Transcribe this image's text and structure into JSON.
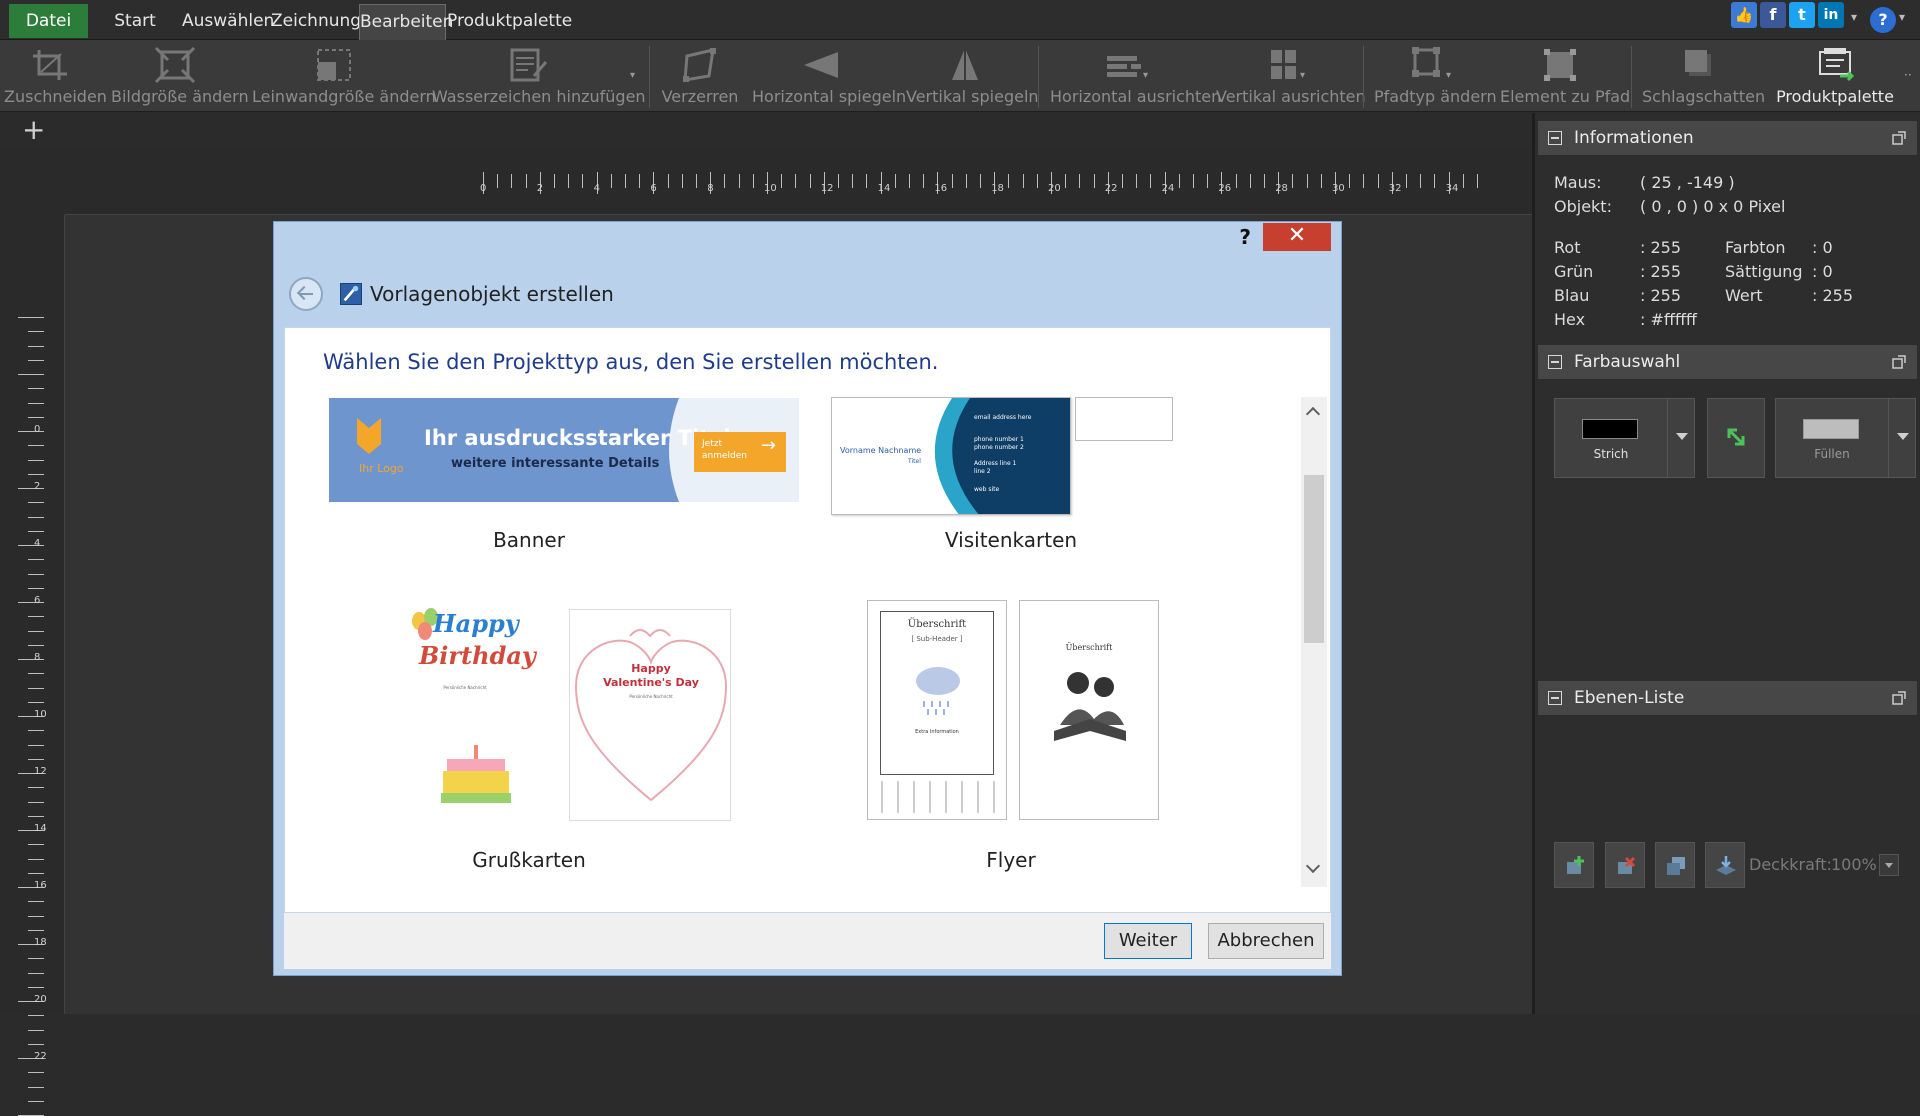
{
  "menubar": {
    "items": [
      "Datei",
      "Start",
      "Auswählen",
      "Zeichnung",
      "Bearbeiten",
      "Produktpalette"
    ]
  },
  "toolbar": {
    "items": [
      {
        "label": "Zuschneiden",
        "icon": "crop-icon"
      },
      {
        "label": "Bildgröße ändern",
        "icon": "resize-image-icon"
      },
      {
        "label": "Leinwandgröße ändern",
        "icon": "canvas-size-icon"
      },
      {
        "label": "Wasserzeichen hinzufügen",
        "icon": "watermark-icon"
      },
      {
        "label": "Verzerren",
        "icon": "distort-icon"
      },
      {
        "label": "Horizontal spiegeln",
        "icon": "flip-horizontal-icon"
      },
      {
        "label": "Vertikal spiegeln",
        "icon": "flip-vertical-icon"
      },
      {
        "label": "Horizontal ausrichten",
        "icon": "align-horizontal-icon"
      },
      {
        "label": "Vertikal ausrichten",
        "icon": "align-vertical-icon"
      },
      {
        "label": "Pfadtyp ändern",
        "icon": "path-type-icon"
      },
      {
        "label": "Element zu Pfad",
        "icon": "element-to-path-icon"
      },
      {
        "label": "Schlagschatten",
        "icon": "drop-shadow-icon"
      },
      {
        "label": "Produktpalette",
        "icon": "product-palette-icon"
      }
    ]
  },
  "ruler": {
    "top": [
      "0",
      "2",
      "4",
      "6",
      "8",
      "10",
      "12",
      "14",
      "16",
      "18",
      "20",
      "22",
      "24",
      "26",
      "28",
      "30",
      "32",
      "34"
    ],
    "left": [
      "0",
      "2",
      "4",
      "6",
      "8",
      "10",
      "12",
      "14",
      "16",
      "18",
      "20",
      "22"
    ]
  },
  "info_panel": {
    "title": "Informationen",
    "maus_label": "Maus:",
    "maus_value": "( 25 , -149 )",
    "objekt_label": "Objekt:",
    "objekt_value": "( 0 , 0 ) 0 x 0 Pixel",
    "rot_label": "Rot",
    "rot_value": ": 255",
    "gruen_label": "Grün",
    "gruen_value": ": 255",
    "blau_label": "Blau",
    "blau_value": ": 255",
    "hex_label": "Hex",
    "hex_value": ": #ffffff",
    "farbton_label": "Farbton",
    "farbton_value": ": 0",
    "saettigung_label": "Sättigung",
    "saettigung_value": ": 0",
    "wert_label": "Wert",
    "wert_value": ": 255"
  },
  "color_panel": {
    "title": "Farbauswahl",
    "stroke_label": "Strich",
    "fill_label": "Füllen",
    "stroke_color": "#000000",
    "fill_color": "#bdbdbd"
  },
  "layers_panel": {
    "title": "Ebenen-Liste",
    "opacity_label": "Deckkraft:",
    "opacity_value": "100%"
  },
  "dialog": {
    "help": "?",
    "close": "✕",
    "title": "Vorlagenobjekt erstellen",
    "prompt": "Wählen Sie den Projekttyp aus, den Sie erstellen möchten.",
    "templates": [
      {
        "caption": "Banner"
      },
      {
        "caption": "Visitenkarten"
      },
      {
        "caption": "Grußkarten"
      },
      {
        "caption": "Flyer"
      }
    ],
    "banner": {
      "title": "Ihr ausdrucksstarker Titel",
      "subtitle": "weitere interessante Details",
      "logo": "Ihr Logo",
      "cta": "Jetzt anmelden"
    },
    "card": {
      "name": "Vorname Nachname",
      "role": "Titel",
      "email": "email address here",
      "phone1": "phone number 1",
      "phone2": "phone number 2",
      "addr1": "Address line 1",
      "addr2": "line 2",
      "web": "web site"
    },
    "greeting": {
      "birthday1": "Happy",
      "birthday2": "Birthday",
      "valentine1": "Happy",
      "valentine2": "Valentine's Day",
      "small": "Persönliche Nachricht"
    },
    "flyer": {
      "heading": "Überschrift",
      "subheading": "[ Sub-Header ]",
      "extra": "Extra Information"
    },
    "next_button": "Weiter",
    "cancel_button": "Abbrechen"
  }
}
